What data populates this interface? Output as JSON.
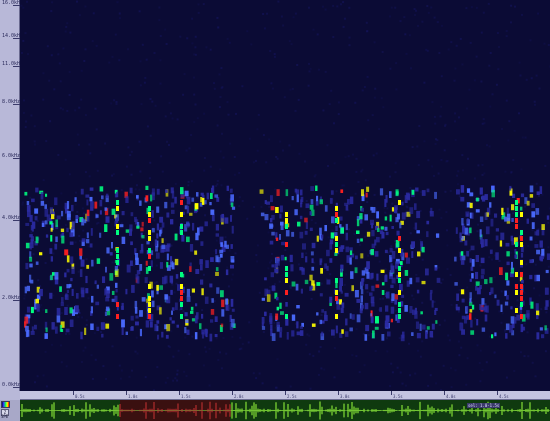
{
  "freq_ruler": {
    "labels": [
      "16.0kHz",
      "14.0kHz",
      "12.0kHz",
      "11.0kHz",
      "8.0kHz",
      "6.0kHz",
      "4.0kHz",
      "2.0kHz",
      "0.0kHz"
    ]
  },
  "time_ruler": {
    "labels": [
      "0.5s",
      "1.0s",
      "1.5s",
      "2.0s",
      "2.5s",
      "3.0s",
      "3.5s",
      "4.0s",
      "4.5s"
    ]
  },
  "controls": {
    "zoom_label": "Z",
    "side_text_1": "SPE",
    "side_text_2": "WAV"
  },
  "waveform": {
    "selection_label": "sel: 1.0-1.5s",
    "selection_color": "#c83232",
    "wave_color": "#9aff3c"
  },
  "colors": {
    "background": "#0b0b35",
    "low": "#2a2aa0",
    "mid": "#4a6aff",
    "high": "#00ff80",
    "peak": "#ffff00",
    "max": "#ff2020"
  }
}
